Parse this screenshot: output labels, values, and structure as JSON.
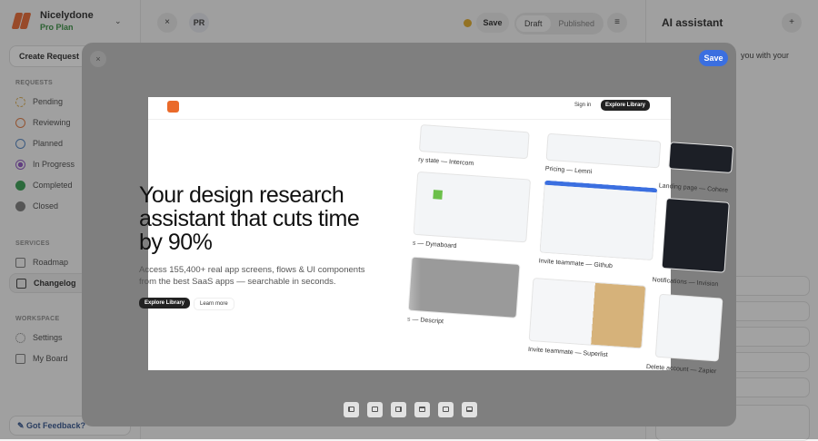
{
  "sidebar": {
    "brand": "Nicelydone",
    "plan": "Pro Plan",
    "create": "Create Request",
    "requests_title": "REQUESTS",
    "requests": [
      {
        "label": "Pending",
        "color": "#d9a84a"
      },
      {
        "label": "Reviewing",
        "color": "#e0743a"
      },
      {
        "label": "Planned",
        "color": "#4a7fc0"
      },
      {
        "label": "In Progress",
        "color": "#8a4fc0"
      },
      {
        "label": "Completed",
        "color": "#2f9a4a"
      },
      {
        "label": "Closed",
        "color": "#777777"
      }
    ],
    "services_title": "SERVICES",
    "services": [
      {
        "label": "Roadmap"
      },
      {
        "label": "Changelog"
      }
    ],
    "workspace_title": "WORKSPACE",
    "workspace": [
      {
        "label": "Settings"
      },
      {
        "label": "My Board"
      }
    ],
    "feedback": "Got Feedback?"
  },
  "header": {
    "close": "×",
    "avatar": "PR",
    "save": "Save",
    "draft": "Draft",
    "published": "Published",
    "menu": "≡"
  },
  "assistant": {
    "title": "AI assistant",
    "add": "+",
    "intro": "you with your"
  },
  "modal": {
    "close": "×",
    "save": "Save",
    "preview": {
      "signin": "Sign in",
      "explore": "Explore Library",
      "headline": "Your design research assistant that cuts time by 90%",
      "sub": "Access 155,400+ real app screens, flows & UI components from the best SaaS apps — searchable in seconds.",
      "explore_btn": "Explore Library",
      "learn": "Learn more",
      "captions": [
        "ry state — Intercom",
        "Pricing — Lemni",
        "Landing page — Cohere",
        "s — Dynaboard",
        "Invite teammate — Github",
        "Notifications — Invision",
        "s — Descript",
        "Invite teammate — Superlist",
        "Delete account — Zapier"
      ]
    },
    "align_tools": [
      "align-left",
      "align-center-horizontal",
      "align-right",
      "align-top",
      "align-center-vertical",
      "align-bottom"
    ]
  }
}
